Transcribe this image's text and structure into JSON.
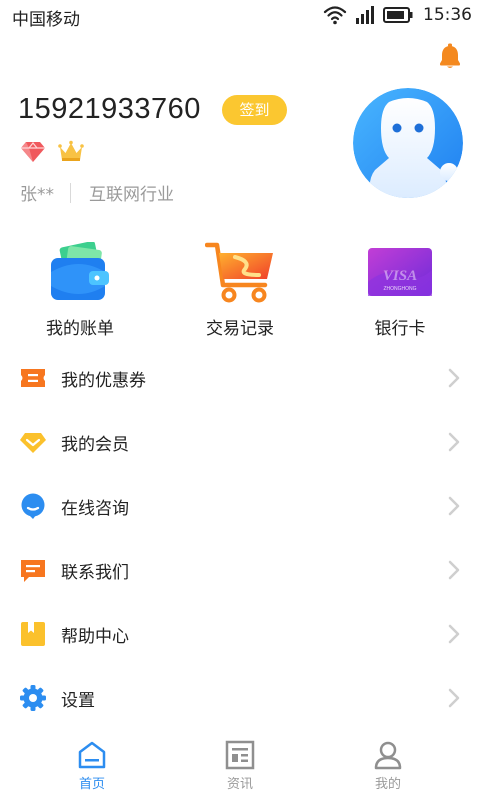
{
  "status_bar": {
    "carrier": "中国移动",
    "time": "15:36",
    "icons": [
      "wifi-icon",
      "signal-icon",
      "battery-icon"
    ]
  },
  "header": {
    "bell_icon": "bell-icon",
    "accent_color": "#f4891f"
  },
  "profile": {
    "phone": "15921933760",
    "checkin_label": "签到",
    "checkin_color": "#fbc730",
    "badges": [
      "diamond-icon",
      "crown-icon"
    ],
    "user_name": "张**",
    "industry": "互联网行业",
    "avatar_icon": "robot-avatar-icon"
  },
  "quick_actions": [
    {
      "label": "我的账单",
      "icon": "wallet-icon"
    },
    {
      "label": "交易记录",
      "icon": "cart-icon"
    },
    {
      "label": "银行卡",
      "icon": "bank-card-icon"
    }
  ],
  "bank_card_text": "VISA",
  "bank_card_sub": "ZHONGHONG",
  "menu": [
    {
      "label": "我的优惠券",
      "icon": "coupon-icon"
    },
    {
      "label": "我的会员",
      "icon": "membership-icon"
    },
    {
      "label": "在线咨询",
      "icon": "chat-icon"
    },
    {
      "label": "联系我们",
      "icon": "message-icon"
    },
    {
      "label": "帮助中心",
      "icon": "help-book-icon"
    },
    {
      "label": "设置",
      "icon": "settings-gear-icon"
    }
  ],
  "tabbar": {
    "active_color": "#2c8df0",
    "tabs": [
      {
        "label": "首页",
        "icon": "home-icon",
        "active": true
      },
      {
        "label": "资讯",
        "icon": "news-icon",
        "active": false
      },
      {
        "label": "我的",
        "icon": "profile-icon",
        "active": false
      }
    ]
  }
}
